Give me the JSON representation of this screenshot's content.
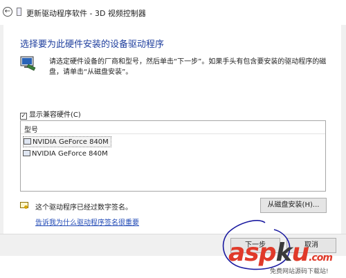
{
  "window": {
    "title": "更新驱动程序软件 - 3D 视频控制器",
    "back_glyph": "←"
  },
  "heading": "选择要为此硬件安装的设备驱动程序",
  "intro": "请选定硬件设备的厂商和型号，然后单击“下一步”。如果手头有包含要安装的驱动程序的磁盘，请单击“从磁盘安装”。",
  "compat": {
    "checked": true,
    "check_glyph": "✓",
    "label": "显示兼容硬件(C)"
  },
  "list": {
    "column_header": "型号",
    "rows": [
      "NVIDIA GeForce 840M",
      "NVIDIA GeForce 840M"
    ]
  },
  "signed_text": "这个驱动程序已经过数字签名。",
  "why_link": "告诉我为什么驱动程序签名很重要",
  "buttons": {
    "have_disk": "从磁盘安装(H)...",
    "next": "下一步",
    "cancel": "取消"
  },
  "watermark": {
    "main": "asp",
    "k": "k",
    "tail": "u",
    "suffix": ".com",
    "sub": "免费网站源码下载站!"
  },
  "colors": {
    "heading": "#1f3f9e",
    "link": "#1f48b5",
    "annotation": "#1a1aa0",
    "watermark": "#e03a2a"
  }
}
